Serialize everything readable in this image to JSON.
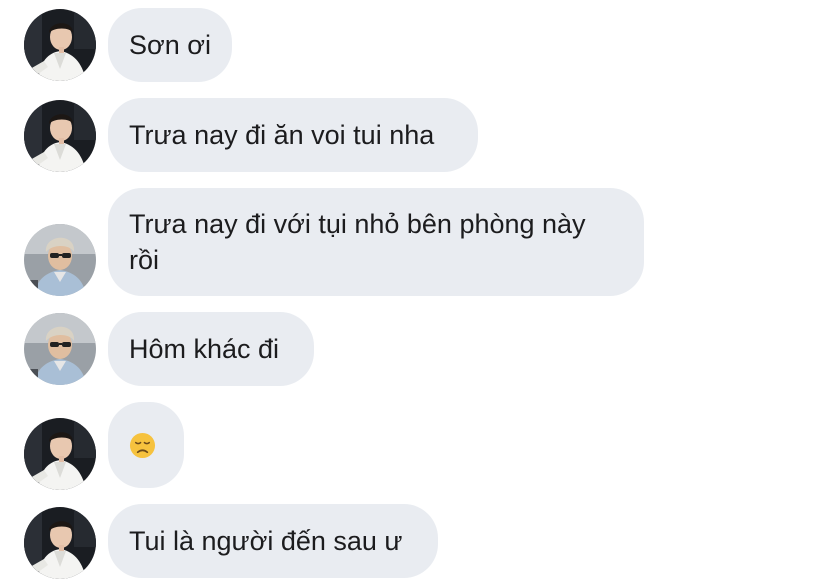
{
  "messages": [
    {
      "sender": "friend",
      "text": "Sơn ơi"
    },
    {
      "sender": "friend",
      "text": "Trưa nay đi ăn voi tui nha"
    },
    {
      "sender": "son",
      "text": "Trưa nay đi với tụi nhỏ bên phòng này rồi"
    },
    {
      "sender": "son",
      "text": "Hôm khác đi"
    },
    {
      "sender": "friend",
      "emoji": "disappointed-face"
    },
    {
      "sender": "friend",
      "text": "Tui là người đến sau ư"
    }
  ],
  "colors": {
    "bubble": "#e9ecf1",
    "text": "#1c1c1e",
    "emoji": "#f6c23e"
  }
}
